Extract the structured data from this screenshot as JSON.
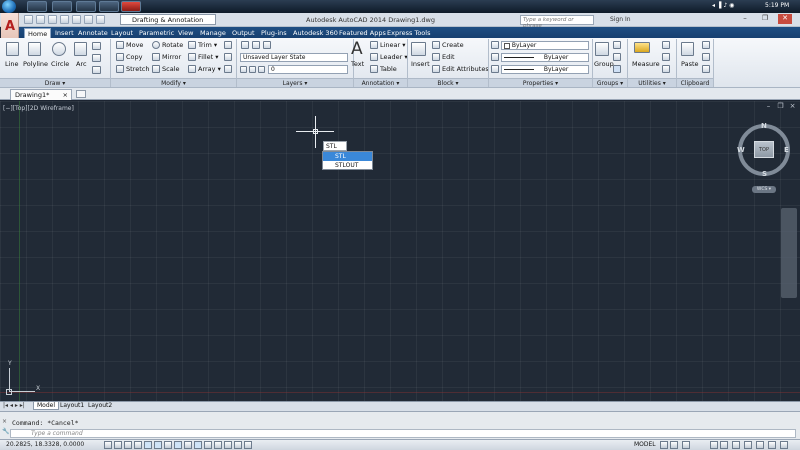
{
  "taskbar": {
    "time": "5:19 PM"
  },
  "title": {
    "workspace": "Drafting & Annotation",
    "app_title": "Autodesk AutoCAD 2014    Drawing1.dwg",
    "search_placeholder": "Type a keyword or phrase",
    "sign_in": "Sign In"
  },
  "ribbon_tabs": [
    "Home",
    "Insert",
    "Annotate",
    "Layout",
    "Parametric",
    "View",
    "Manage",
    "Output",
    "Plug-ins",
    "Autodesk 360",
    "Featured Apps",
    "Express Tools"
  ],
  "draw": {
    "line": "Line",
    "polyline": "Polyline",
    "circle": "Circle",
    "arc": "Arc",
    "label": "Draw ▾"
  },
  "modify": {
    "move": "Move",
    "rotate": "Rotate",
    "trim": "Trim ▾",
    "copy": "Copy",
    "mirror": "Mirror",
    "fillet": "Fillet ▾",
    "stretch": "Stretch",
    "scale": "Scale",
    "array": "Array ▾",
    "label": "Modify ▾"
  },
  "layers": {
    "state": "Unsaved Layer State",
    "current": "0",
    "label": "Layers ▾"
  },
  "annotation": {
    "text": "Text",
    "linear": "Linear ▾",
    "leader": "Leader ▾",
    "table": "Table",
    "label": "Annotation ▾"
  },
  "block": {
    "insert": "Insert",
    "create": "Create",
    "edit": "Edit",
    "edit_attributes": "Edit Attributes ▾",
    "label": "Block ▾"
  },
  "properties": {
    "color": "ByLayer",
    "lineweight": "ByLayer",
    "linetype": "ByLayer",
    "label": "Properties ▾"
  },
  "groups": {
    "group": "Group",
    "label": "Groups ▾"
  },
  "utilities": {
    "measure": "Measure",
    "label": "Utilities ▾"
  },
  "clipboard": {
    "paste": "Paste",
    "label": "Clipboard"
  },
  "doc_tab": "Drawing1*",
  "viewport": {
    "controls": "[−][Top][2D Wireframe]",
    "dynamic_input": "STL",
    "autocomplete": [
      "STL",
      "STLOUT"
    ],
    "viewcube": {
      "top": "TOP",
      "n": "N",
      "s": "S",
      "e": "E",
      "w": "W"
    },
    "wcs": "WCS ▾",
    "ucs_x": "X",
    "ucs_y": "Y"
  },
  "layout_tabs": [
    "Model",
    "Layout1",
    "Layout2"
  ],
  "command": {
    "history": "Command: *Cancel*",
    "placeholder": "Type a command"
  },
  "status": {
    "coords": "20.2825, 18.3328, 0.0000",
    "model": "MODEL"
  }
}
